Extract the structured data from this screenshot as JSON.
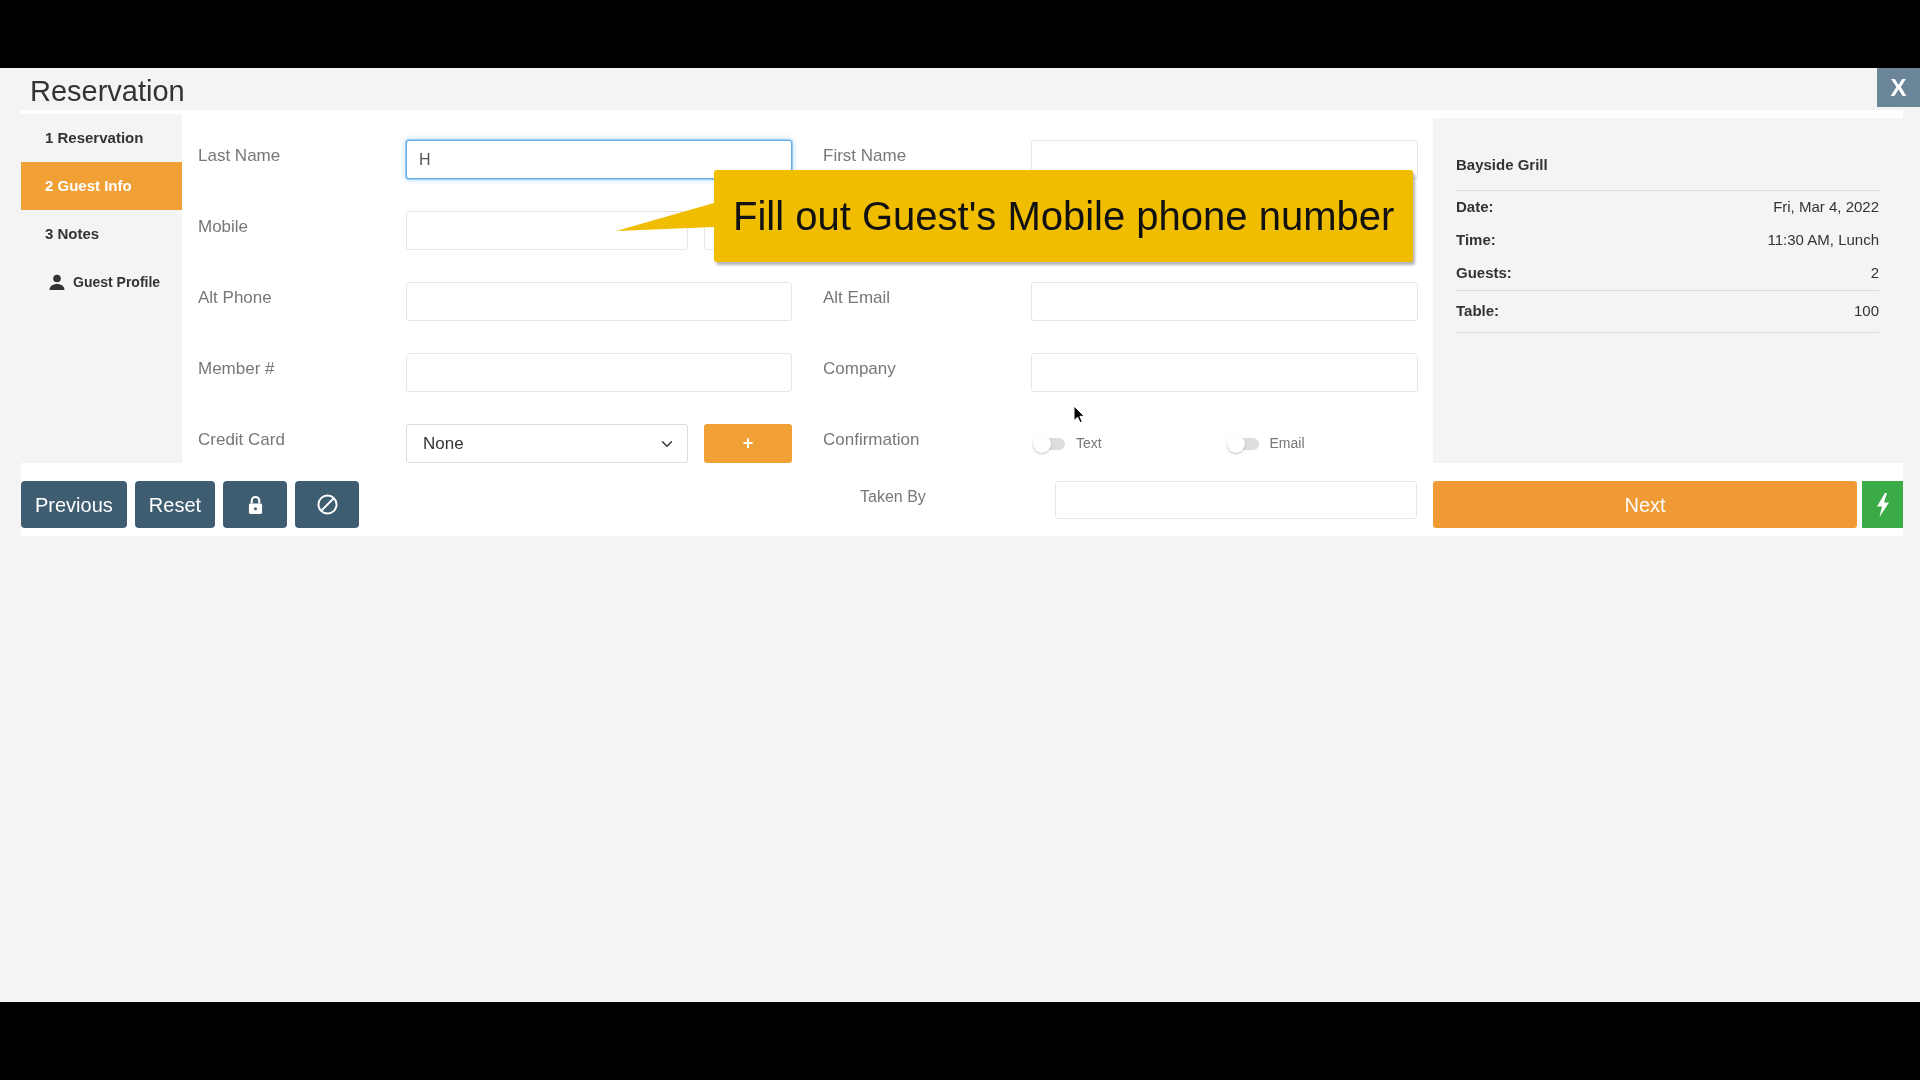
{
  "window": {
    "title": "Reservation",
    "close_label": "X"
  },
  "steps": [
    {
      "label": "1 Reservation",
      "kind": "step",
      "selected": false
    },
    {
      "label": "2 Guest Info",
      "kind": "step",
      "selected": true
    },
    {
      "label": "3 Notes",
      "kind": "step",
      "selected": false
    },
    {
      "label": "Guest Profile",
      "kind": "profile",
      "selected": false
    }
  ],
  "form": {
    "rows": [
      {
        "left": {
          "label": "Last Name",
          "kind": "text",
          "value": "H",
          "focused": true
        },
        "right": {
          "label": "First Name",
          "kind": "text",
          "focused": false
        }
      },
      {
        "left": {
          "label": "Mobile",
          "kind": "split",
          "focused": false
        }
      },
      {
        "left": {
          "label": "Alt Phone",
          "kind": "text",
          "focused": false
        },
        "right": {
          "label": "Alt Email",
          "kind": "text",
          "focused": false
        }
      },
      {
        "left": {
          "label": "Member #",
          "kind": "text",
          "focused": false
        },
        "right": {
          "label": "Company",
          "kind": "text",
          "focused": false
        }
      },
      {
        "left": {
          "label": "Credit Card",
          "kind": "select",
          "value": "None",
          "button": "+"
        },
        "right": {
          "label": "Confirmation",
          "kind": "toggles",
          "options": [
            {
              "label": "Text",
              "on": false
            },
            {
              "label": "Email",
              "on": false
            }
          ]
        }
      }
    ]
  },
  "summary": {
    "title": "Bayside Grill",
    "groups": [
      [
        {
          "label": "Date:",
          "value": "Fri, Mar 4, 2022"
        },
        {
          "label": "Time:",
          "value": "11:30 AM, Lunch"
        },
        {
          "label": "Guests:",
          "value": "2"
        }
      ],
      [
        {
          "label": "Table:",
          "value": "100"
        }
      ]
    ]
  },
  "footer": {
    "buttons": [
      {
        "kind": "text",
        "label": "Previous"
      },
      {
        "kind": "text",
        "label": "Reset"
      },
      {
        "kind": "lock"
      },
      {
        "kind": "ban"
      }
    ],
    "taken_by": {
      "label": "Taken By"
    },
    "next": "Next"
  },
  "callout": {
    "text": "Fill out Guest's Mobile phone number"
  }
}
